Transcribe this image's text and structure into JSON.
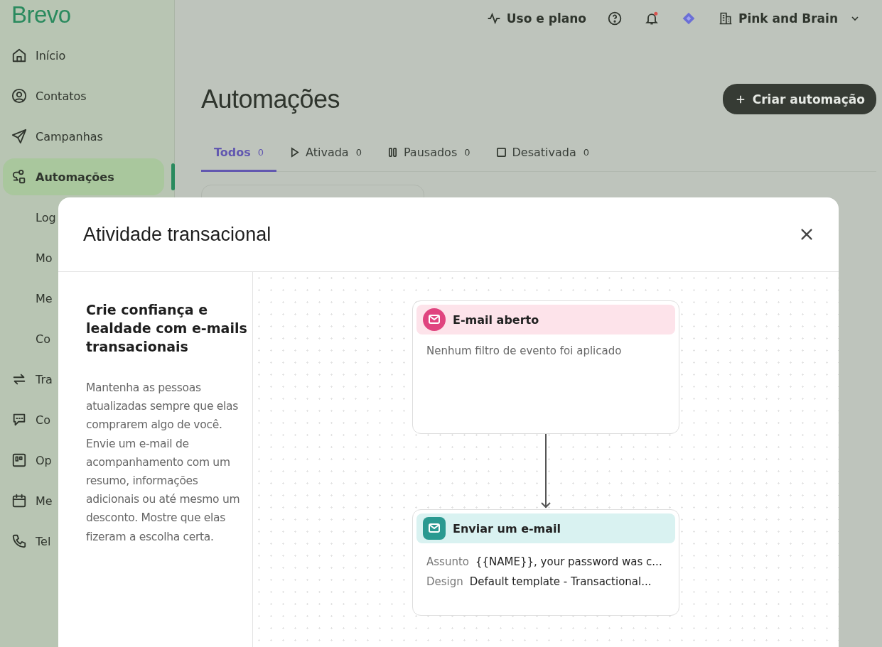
{
  "sidebar": {
    "logo": "Brevo",
    "items": [
      {
        "label": "Início",
        "kind": "main",
        "selected": false
      },
      {
        "label": "Contatos",
        "kind": "main",
        "selected": false
      },
      {
        "label": "Campanhas",
        "kind": "main",
        "selected": false
      },
      {
        "label": "Automações",
        "kind": "main",
        "selected": true
      },
      {
        "label": "Log",
        "kind": "sub",
        "selected": false
      },
      {
        "label": "Mo",
        "kind": "sub",
        "selected": false
      },
      {
        "label": "Me",
        "kind": "sub",
        "selected": false
      },
      {
        "label": "Co",
        "kind": "sub",
        "selected": false
      },
      {
        "label": "Tra",
        "kind": "main",
        "selected": false
      },
      {
        "label": "Co",
        "kind": "main",
        "selected": false
      },
      {
        "label": "Op",
        "kind": "main",
        "selected": false
      },
      {
        "label": "Me",
        "kind": "main",
        "selected": false
      },
      {
        "label": "Tel",
        "kind": "main",
        "selected": false
      }
    ]
  },
  "topbar": {
    "usage": "Uso e plano",
    "notification_dot": true,
    "account": "Pink and Brain"
  },
  "page": {
    "title": "Automações",
    "create_button": "Criar automação",
    "tabs": [
      {
        "label": "Todos",
        "count": "0",
        "selected": true
      },
      {
        "label": "Ativada",
        "count": "0",
        "selected": false
      },
      {
        "label": "Pausados",
        "count": "0",
        "selected": false
      },
      {
        "label": "Desativada",
        "count": "0",
        "selected": false
      }
    ]
  },
  "modal": {
    "title": "Atividade transacional",
    "heading": "Crie confiança e lealdade com e-mails transacionais",
    "description": "Mantenha as pessoas atualizadas sempre que elas comprarem algo de você. Envie um e-mail de acompanhamento com um resumo, informações adicionais ou até mesmo um desconto. Mostre que elas fizeram a escolha certa.",
    "nodes": [
      {
        "kind": "trigger",
        "title": "E-mail aberto",
        "text": "Nenhum filtro de evento foi aplicado"
      },
      {
        "kind": "action",
        "title": "Enviar um e-mail",
        "fields": [
          {
            "label": "Assunto",
            "value": "{{NAME}}, your password was c..."
          },
          {
            "label": "Design",
            "value": "Default template - Transactional..."
          }
        ]
      }
    ]
  }
}
